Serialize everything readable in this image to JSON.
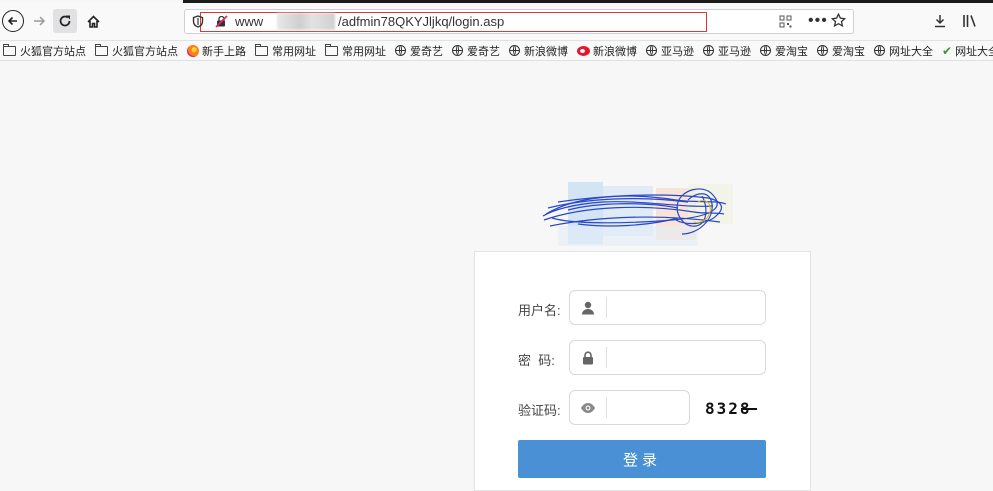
{
  "browser": {
    "url_prefix": "www",
    "url_suffix": "/adfmin78QKYJljkq/login.asp",
    "more_label": "•••"
  },
  "bookmarks": [
    {
      "label": "火狐官方站点",
      "icon": "folder-icon"
    },
    {
      "label": "火狐官方站点",
      "icon": "folder-icon"
    },
    {
      "label": "新手上路",
      "icon": "firefox-icon"
    },
    {
      "label": "常用网址",
      "icon": "folder-icon"
    },
    {
      "label": "常用网址",
      "icon": "folder-icon"
    },
    {
      "label": "爱奇艺",
      "icon": "globe-icon"
    },
    {
      "label": "爱奇艺",
      "icon": "globe-icon"
    },
    {
      "label": "新浪微博",
      "icon": "globe-icon"
    },
    {
      "label": "新浪微博",
      "icon": "weibo-icon"
    },
    {
      "label": "亚马逊",
      "icon": "globe-icon"
    },
    {
      "label": "亚马逊",
      "icon": "globe-icon"
    },
    {
      "label": "爱淘宝",
      "icon": "globe-icon"
    },
    {
      "label": "爱淘宝",
      "icon": "globe-icon"
    },
    {
      "label": "网址大全",
      "icon": "globe-icon"
    },
    {
      "label": "网址大全",
      "icon": "check-icon"
    }
  ],
  "login": {
    "username_label": "用户名:",
    "password_label": "密  码:",
    "captcha_label": "验证码:",
    "captcha_code": "8328",
    "submit_label": "登录"
  },
  "colors": {
    "accent": "#4a90d4",
    "url_highlight": "#d83a3a"
  }
}
